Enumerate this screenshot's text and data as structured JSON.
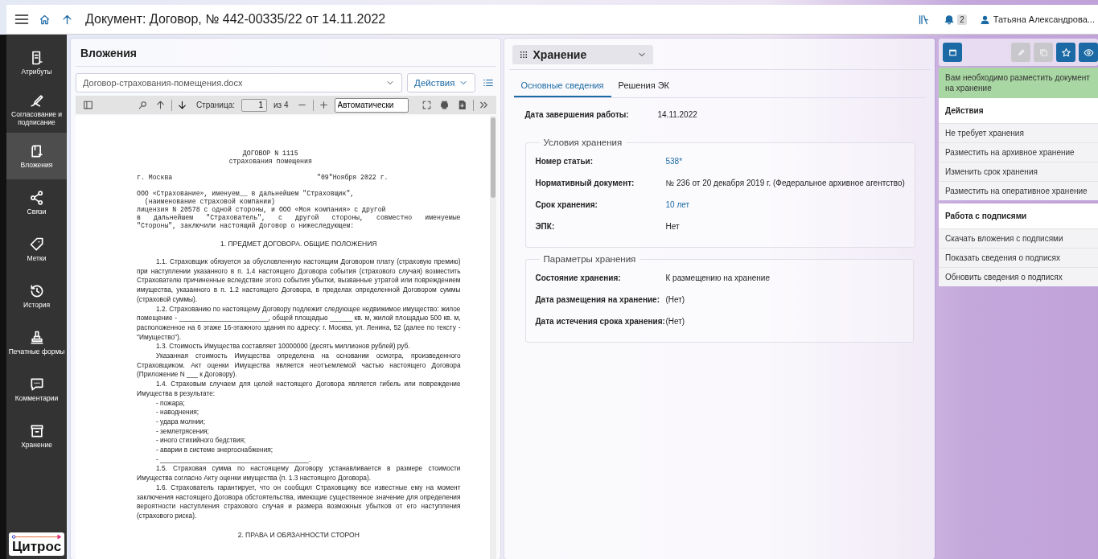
{
  "topbar": {
    "title": "Документ: Договор, № 442-00335/22 от 14.11.2022",
    "notification_count": "2",
    "user_name": "Татьяна Александрова..."
  },
  "sidebar": {
    "items": [
      {
        "label": "Атрибуты",
        "selected": false
      },
      {
        "label": "Согласование и подписание",
        "selected": false
      },
      {
        "label": "Вложения",
        "selected": true
      },
      {
        "label": "Связи",
        "selected": false
      },
      {
        "label": "Метки",
        "selected": false
      },
      {
        "label": "История",
        "selected": false
      },
      {
        "label": "Печатные формы",
        "selected": false
      },
      {
        "label": "Комментарии",
        "selected": false
      },
      {
        "label": "Хранение",
        "selected": false
      }
    ],
    "logo": "Цитрос"
  },
  "attachments": {
    "title": "Вложения",
    "file": "Договор-страхования-помещения.docx",
    "actions_button": "Действия",
    "viewer_toolbar": {
      "page_label": "Страница:",
      "page_value": "1",
      "page_total": "из 4",
      "zoom": "Автоматически"
    },
    "document": [
      {
        "kind": "mono-center",
        "text": "ДОГОВОР N 1115"
      },
      {
        "kind": "mono-center",
        "text": "страхования помещения"
      },
      {
        "kind": "mono-split",
        "text": "г. Москва",
        "right": "\"09\"Ноября 2022 г."
      },
      {
        "kind": "mono",
        "text": "ООО «Страхование», именуем__ в дальнейшем \"Страховщик\","
      },
      {
        "kind": "mono",
        "text": "  (наименование страховой компании)"
      },
      {
        "kind": "mono",
        "text": "лицензия N 20578 с одной стороны, и ООО «Моя компания» с другой"
      },
      {
        "kind": "mono-justify",
        "text": "в дальнейшем \"Страхователь\", с другой стороны, совместно именуемые"
      },
      {
        "kind": "mono",
        "text": "\"Стороны\", заключили настоящий Договор о нижеследующем:"
      },
      {
        "kind": "heading",
        "text": "1. ПРЕДМЕТ ДОГОВОРА. ОБЩИЕ ПОЛОЖЕНИЯ"
      },
      {
        "kind": "para",
        "text": "1.1. Страховщик обязуется за обусловленную настоящим Договором плату (страховую премию) при наступлении указанного в п. 1.4 настоящего Договора события (страхового случая) возместить Страхователю причиненные вследствие этого события убытки, вызванные утратой или повреждением имущества, указанного в п. 1.2 настоящего Договора, в пределах определенной Договором суммы (страховой суммы)."
      },
      {
        "kind": "para",
        "text": "1.2. Страхованию по настоящему Договору подлежит следующее недвижимое имущество: жилое помещение - ________________________, общей площадью ______ кв. м, жилой площадью 500 кв. м, расположенное на 6 этаже 16-этажного здания по адресу: г. Москва, ул. Ленина, 52 (далее по тексту - \"Имущество\")."
      },
      {
        "kind": "para",
        "text": "1.3. Стоимость Имущества составляет 10000000 (десять миллионов рублей) руб."
      },
      {
        "kind": "para",
        "text": "Указанная стоимость Имущества определена на основании осмотра, произведенного Страховщиком. Акт оценки Имущества является неотъемлемой частью настоящего Договора (Приложение N ___ к Договору)."
      },
      {
        "kind": "para",
        "text": "1.4. Страховым случаем для целей настоящего Договора является гибель или повреждение Имущества в результате:"
      },
      {
        "kind": "list",
        "text": "- пожара;"
      },
      {
        "kind": "list",
        "text": "- наводнения;"
      },
      {
        "kind": "list",
        "text": "- удара молнии;"
      },
      {
        "kind": "list",
        "text": "- землетрясения;"
      },
      {
        "kind": "list",
        "text": "- иного стихийного бедствия;"
      },
      {
        "kind": "list",
        "text": "- аварии в системе энергоснабжения;"
      },
      {
        "kind": "list",
        "text": "- ________________________________________."
      },
      {
        "kind": "para",
        "text": "1.5. Страховая сумма по настоящему Договору устанавливается в размере стоимости Имущества согласно Акту оценки имущества (п. 1.3 настоящего Договора)."
      },
      {
        "kind": "para",
        "text": "1.6. Страхователь гарантирует, что он сообщил Страховщику все известные ему на момент заключения настоящего Договора обстоятельства, имеющие существенное значение для определения вероятности наступления страхового случая и размера возможных убытков от его наступления (страхового риска)."
      },
      {
        "kind": "heading",
        "text": "2. ПРАВА И ОБЯЗАННОСТИ СТОРОН"
      }
    ]
  },
  "storage": {
    "title": "Хранение",
    "tabs": [
      {
        "label": "Основные сведения",
        "selected": true
      },
      {
        "label": "Решения ЭК",
        "selected": false
      }
    ],
    "fields": [
      {
        "label": "Дата завершения работы:",
        "value": "14.11.2022",
        "link": false
      }
    ],
    "groups": [
      {
        "title": "Условия хранения",
        "fields": [
          {
            "label": "Номер статьи:",
            "value": "538*",
            "link": true
          },
          {
            "label": "Нормативный документ:",
            "value": "№ 236 от 20 декабря 2019 г. (Федеральное архивное агентство)",
            "link": false
          },
          {
            "label": "Срок хранения:",
            "value": "10 лет",
            "link": true
          },
          {
            "label": "ЭПК:",
            "value": "Нет",
            "link": false
          }
        ]
      },
      {
        "title": "Параметры хранения",
        "fields": [
          {
            "label": "Состояние хранения:",
            "value": "К размещению на хранение",
            "link": false
          },
          {
            "label": "Дата размещения на хранение:",
            "value": "(Нет)",
            "link": false
          },
          {
            "label": "Дата истечения срока хранения:",
            "value": "(Нет)",
            "link": false
          }
        ]
      }
    ]
  },
  "actions_panel": {
    "buttons": [
      {
        "disabled": false
      },
      {
        "disabled": true
      },
      {
        "disabled": true
      },
      {
        "disabled": false
      },
      {
        "disabled": false
      }
    ],
    "notice": "Вам необходимо разместить документ на хранение",
    "sections": [
      {
        "title": "Действия",
        "items": [
          "Не требует хранения",
          "Разместить на архивное хранение",
          "Изменить срок хранения",
          "Разместить на оперативное хранение"
        ]
      },
      {
        "title": "Работа с подписями",
        "items": [
          "Скачать вложения с подписями",
          "Показать сведения о подписях",
          "Обновить сведения о подписях"
        ]
      }
    ]
  }
}
